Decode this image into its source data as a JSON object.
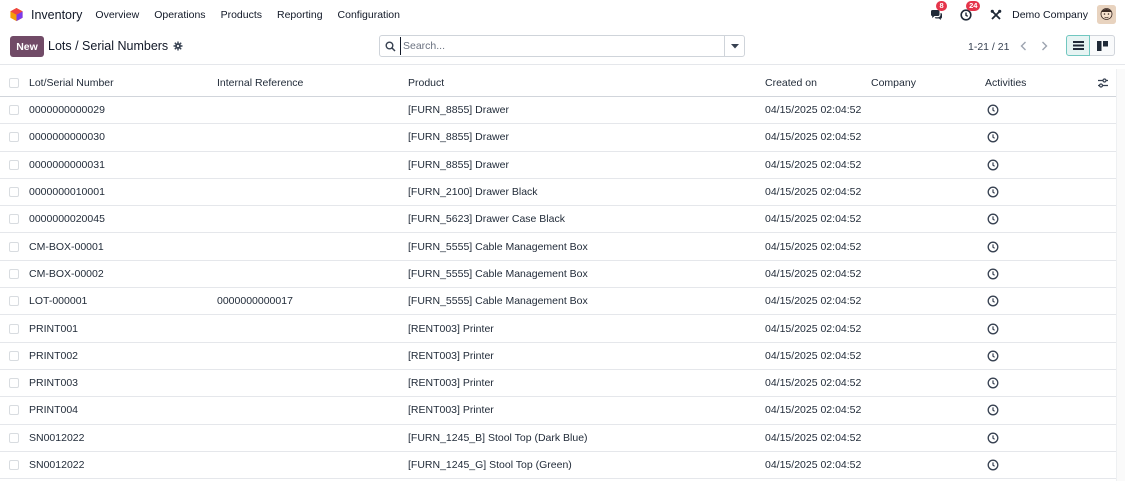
{
  "nav": {
    "app_name": "Inventory",
    "menu": [
      "Overview",
      "Operations",
      "Products",
      "Reporting",
      "Configuration"
    ],
    "messages_badge": "8",
    "activities_badge": "24",
    "company": "Demo Company"
  },
  "control": {
    "new_label": "New",
    "title": "Lots / Serial Numbers",
    "search_placeholder": "Search...",
    "pager": "1-21 / 21"
  },
  "table": {
    "headers": {
      "lot": "Lot/Serial Number",
      "ref": "Internal Reference",
      "product": "Product",
      "created": "Created on",
      "company": "Company",
      "activities": "Activities"
    },
    "rows": [
      {
        "lot": "0000000000029",
        "ref": "",
        "product": "[FURN_8855] Drawer",
        "created": "04/15/2025 02:04:52",
        "company": ""
      },
      {
        "lot": "0000000000030",
        "ref": "",
        "product": "[FURN_8855] Drawer",
        "created": "04/15/2025 02:04:52",
        "company": ""
      },
      {
        "lot": "0000000000031",
        "ref": "",
        "product": "[FURN_8855] Drawer",
        "created": "04/15/2025 02:04:52",
        "company": ""
      },
      {
        "lot": "0000000010001",
        "ref": "",
        "product": "[FURN_2100] Drawer Black",
        "created": "04/15/2025 02:04:52",
        "company": ""
      },
      {
        "lot": "0000000020045",
        "ref": "",
        "product": "[FURN_5623] Drawer Case Black",
        "created": "04/15/2025 02:04:52",
        "company": ""
      },
      {
        "lot": "CM-BOX-00001",
        "ref": "",
        "product": "[FURN_5555] Cable Management Box",
        "created": "04/15/2025 02:04:52",
        "company": ""
      },
      {
        "lot": "CM-BOX-00002",
        "ref": "",
        "product": "[FURN_5555] Cable Management Box",
        "created": "04/15/2025 02:04:52",
        "company": ""
      },
      {
        "lot": "LOT-000001",
        "ref": "0000000000017",
        "product": "[FURN_5555] Cable Management Box",
        "created": "04/15/2025 02:04:52",
        "company": ""
      },
      {
        "lot": "PRINT001",
        "ref": "",
        "product": "[RENT003] Printer",
        "created": "04/15/2025 02:04:52",
        "company": ""
      },
      {
        "lot": "PRINT002",
        "ref": "",
        "product": "[RENT003] Printer",
        "created": "04/15/2025 02:04:52",
        "company": ""
      },
      {
        "lot": "PRINT003",
        "ref": "",
        "product": "[RENT003] Printer",
        "created": "04/15/2025 02:04:52",
        "company": ""
      },
      {
        "lot": "PRINT004",
        "ref": "",
        "product": "[RENT003] Printer",
        "created": "04/15/2025 02:04:52",
        "company": ""
      },
      {
        "lot": "SN0012022",
        "ref": "",
        "product": "[FURN_1245_B] Stool Top (Dark Blue)",
        "created": "04/15/2025 02:04:52",
        "company": ""
      },
      {
        "lot": "SN0012022",
        "ref": "",
        "product": "[FURN_1245_G] Stool Top (Green)",
        "created": "04/15/2025 02:04:52",
        "company": ""
      }
    ]
  },
  "colors": {
    "brand": "#714b67",
    "badge": "#e5344a",
    "active_view": "#e6f4f3"
  },
  "icons": [
    "app-logo-icon",
    "chat-icon",
    "clock-icon",
    "tools-icon",
    "gear-icon",
    "search-icon",
    "caret-down-icon",
    "chevron-left-icon",
    "chevron-right-icon",
    "list-view-icon",
    "kanban-view-icon",
    "activity-clock-icon",
    "column-settings-icon"
  ]
}
